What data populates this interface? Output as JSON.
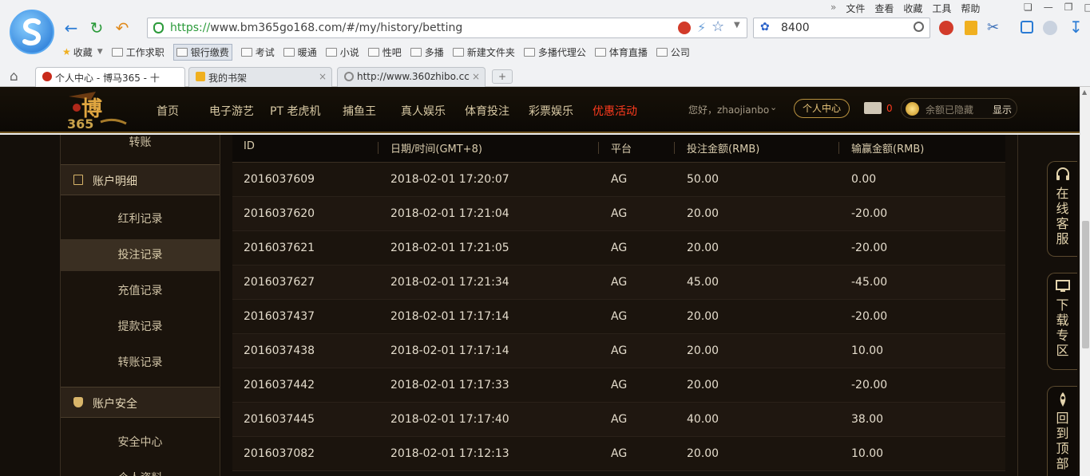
{
  "browser": {
    "url_prefix": "https://",
    "url_rest": "www.bm365go168.com/#/my/history/betting",
    "search_value": "8400",
    "menu": [
      "文件",
      "查看",
      "收藏",
      "工具",
      "帮助"
    ],
    "favorites_label": "收藏",
    "bookmarks": [
      "工作求职",
      "银行缴费",
      "考试",
      "暖通",
      "小说",
      "性吧",
      "多播",
      "新建文件夹",
      "多播代理公",
      "体育直播",
      "公司"
    ],
    "tabs": [
      {
        "label": "个人中心 - 博马365 - 十"
      },
      {
        "label": "我的书架"
      },
      {
        "label": "http://www.360zhibo.cc"
      }
    ]
  },
  "site": {
    "nav": [
      "首页",
      "电子游艺",
      "PT 老虎机",
      "捕鱼王",
      "真人娱乐",
      "体育投注",
      "彩票娱乐",
      "优惠活动"
    ],
    "greeting": "您好，zhaojianbo",
    "center_button": "个人中心",
    "mail_count": "0",
    "balance_label": "余额已隐藏",
    "show_button": "显示"
  },
  "sidebar": {
    "top_item": "转账",
    "account_details": "账户明细",
    "detail_items": [
      "红利记录",
      "投注记录",
      "充值记录",
      "提款记录",
      "转账记录"
    ],
    "account_security": "账户安全",
    "security_items": [
      "安全中心",
      "个人资料"
    ]
  },
  "table": {
    "headers": [
      "ID",
      "日期/时间(GMT+8)",
      "平台",
      "投注金额(RMB)",
      "输赢金额(RMB)"
    ],
    "rows": [
      [
        "2016037609",
        "2018-02-01 17:20:07",
        "AG",
        "50.00",
        "0.00"
      ],
      [
        "2016037620",
        "2018-02-01 17:21:04",
        "AG",
        "20.00",
        "-20.00"
      ],
      [
        "2016037621",
        "2018-02-01 17:21:05",
        "AG",
        "20.00",
        "-20.00"
      ],
      [
        "2016037627",
        "2018-02-01 17:21:34",
        "AG",
        "45.00",
        "-45.00"
      ],
      [
        "2016037437",
        "2018-02-01 17:17:14",
        "AG",
        "20.00",
        "-20.00"
      ],
      [
        "2016037438",
        "2018-02-01 17:17:14",
        "AG",
        "20.00",
        "10.00"
      ],
      [
        "2016037442",
        "2018-02-01 17:17:33",
        "AG",
        "20.00",
        "-20.00"
      ],
      [
        "2016037445",
        "2018-02-01 17:17:40",
        "AG",
        "40.00",
        "38.00"
      ],
      [
        "2016037082",
        "2018-02-01 17:12:13",
        "AG",
        "20.00",
        "10.00"
      ]
    ]
  },
  "floating": {
    "service": "在线客服",
    "download": "下载专区",
    "top": "回到顶部"
  },
  "colors": {
    "accent_gold": "#d8b56a",
    "hot_red": "#ff3b1e",
    "background": "#140f0a"
  }
}
